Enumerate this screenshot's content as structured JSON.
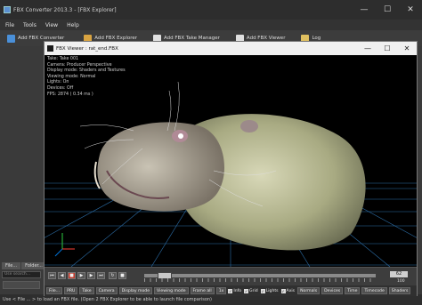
{
  "main_window": {
    "title": "FBX Converter 2013.3 - [FBX Explorer]",
    "controls": {
      "minimize": "—",
      "maximize": "☐",
      "close": "✕"
    },
    "menu": [
      "File",
      "Tools",
      "View",
      "Help"
    ],
    "toolbar": [
      {
        "label": "Add FBX Converter",
        "icon": "convert-icon",
        "color": "#4a90d9"
      },
      {
        "label": "Add FBX Explorer",
        "icon": "explorer-icon",
        "color": "#d9a441"
      },
      {
        "label": "Add FBX Take Manager",
        "icon": "take-manager-icon",
        "color": "#e0e0e0"
      },
      {
        "label": "Add FBX Viewer",
        "icon": "viewer-icon",
        "color": "#e0e0e0"
      },
      {
        "label": "Log",
        "icon": "log-icon",
        "color": "#e0c060"
      }
    ],
    "left_panel": {
      "tabs": [
        "File...",
        "Folder..."
      ],
      "search_placeholder": "Use search..."
    },
    "status": "Use < File ... > to load an FBX file. (Open 2 FBX Explorer to be able to launch file comparison)"
  },
  "viewer": {
    "title": "FBX Viewer : rat_end.FBX",
    "controls": {
      "minimize": "—",
      "maximize": "☐",
      "close": "✕"
    },
    "hud": [
      "Take: Take 001",
      "Camera: Producer Perspective",
      "Display mode: Shaders and Textures",
      "Viewing mode: Normal",
      "Lights: On",
      "Devices: Off",
      "FPS: 2874 ( 0.34 ms )"
    ],
    "transport": {
      "start_frame": "",
      "current_frame": "62",
      "end_frame": "62",
      "end_frame_small": "100",
      "playhead_fraction": 0.06
    },
    "options": {
      "buttons": [
        "File...",
        "PRU",
        "Take",
        "Camera",
        "Display mode",
        "Viewing mode",
        "Frame all"
      ],
      "speed": "1x",
      "checks": [
        {
          "label": "Info",
          "checked": true
        },
        {
          "label": "Grid",
          "checked": true
        },
        {
          "label": "Lights",
          "checked": true
        },
        {
          "label": "Axis",
          "checked": true
        }
      ],
      "right_buttons": [
        "Normals",
        "Devices",
        "Time",
        "Timecode",
        "Shaders"
      ]
    }
  }
}
